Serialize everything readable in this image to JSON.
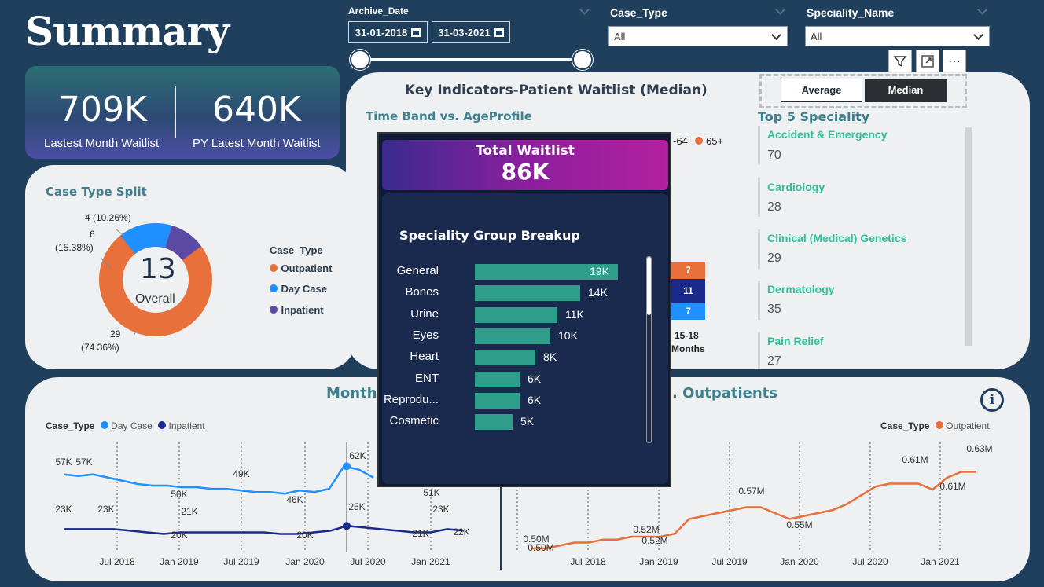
{
  "page_title": "Summary",
  "filters": {
    "archive_label": "Archive_Date",
    "date_from": "31-01-2018",
    "date_to": "31-03-2021",
    "case_type_label": "Case_Type",
    "case_type_value": "All",
    "speciality_label": "Speciality_Name",
    "speciality_value": "All"
  },
  "kpi": {
    "latest_value": "709K",
    "latest_label": "Lastest Month Waitlist",
    "py_value": "640K",
    "py_label": "PY Latest Month Waitlist"
  },
  "toggle": {
    "average": "Average",
    "median": "Median",
    "selected": "Median"
  },
  "key_indicators": {
    "title": "Key Indicators-Patient Waitlist (Median)",
    "timeband_title": "Time Band vs. AgeProfile",
    "legend_partial_1": "-64",
    "legend_partial_2": "65+",
    "visible_bar_values": [
      "7",
      "11",
      "7"
    ],
    "visible_category": "15-18",
    "visible_category_2": "Months"
  },
  "top5": {
    "title": "Top 5 Speciality",
    "items": [
      {
        "name": "Accident & Emergency",
        "value": "70"
      },
      {
        "name": "Cardiology",
        "value": "28"
      },
      {
        "name": "Clinical (Medical) Genetics",
        "value": "29"
      },
      {
        "name": "Dermatology",
        "value": "35"
      },
      {
        "name": "Pain Relief",
        "value": "27"
      }
    ]
  },
  "case_split": {
    "title": "Case Type Split",
    "center_value": "13",
    "center_label": "Overall",
    "legend_title": "Case_Type",
    "legend": [
      {
        "name": "Outpatient",
        "color": "#e8703a"
      },
      {
        "name": "Day Case",
        "color": "#1e90ff"
      },
      {
        "name": "Inpatient",
        "color": "#5b4aa3"
      }
    ],
    "labels": {
      "inpatient": "4 (10.26%)",
      "daycase_a": "6",
      "daycase_b": "(15.38%)",
      "outpatient_a": "29",
      "outpatient_b": "(74.36%)"
    }
  },
  "tooltip": {
    "title": "Total Waitlist",
    "value": "86K",
    "breakup_title": "Speciality Group Breakup",
    "rows": [
      {
        "label": "General",
        "value": 19,
        "text": "19K"
      },
      {
        "label": "Bones",
        "value": 14,
        "text": "14K"
      },
      {
        "label": "Urine",
        "value": 11,
        "text": "11K"
      },
      {
        "label": "Eyes",
        "value": 10,
        "text": "10K"
      },
      {
        "label": "Heart",
        "value": 8,
        "text": "8K"
      },
      {
        "label": "ENT",
        "value": 6,
        "text": "6K"
      },
      {
        "label": "Reprodu...",
        "value": 6,
        "text": "6K"
      },
      {
        "label": "Cosmetic",
        "value": 5,
        "text": "5K"
      }
    ]
  },
  "monthly": {
    "title_left": "Monthl",
    "title_right": ". Outpatients",
    "legend_left_title": "Case_Type",
    "legend_left": [
      "Day Case",
      "Inpatient"
    ],
    "legend_right_title": "Case_Type",
    "legend_right": [
      "Outpatient"
    ],
    "x_ticks": [
      "Jul 2018",
      "Jan 2019",
      "Jul 2019",
      "Jan 2020",
      "Jul 2020",
      "Jan 2021"
    ]
  },
  "chart_data": [
    {
      "type": "line",
      "series": [
        {
          "name": "Day Case",
          "color": "#1e90ff",
          "values": [
            57,
            56,
            57,
            55,
            53,
            51,
            50,
            50,
            49,
            49,
            48,
            48,
            47,
            46,
            46,
            45,
            47,
            46,
            48,
            62,
            60,
            55
          ]
        },
        {
          "name": "Inpatient",
          "color": "#1a2a8c",
          "values": [
            23,
            23,
            23,
            23,
            22,
            21,
            20,
            21,
            21,
            21,
            21,
            21,
            21,
            20,
            20,
            21,
            22,
            25,
            24,
            23,
            22,
            21,
            21,
            23,
            22
          ]
        }
      ],
      "point_labels": [
        {
          "series": "Day Case",
          "labels": [
            "57K",
            "57K",
            "50K",
            "49K",
            "46K",
            "62K",
            "51K"
          ]
        },
        {
          "series": "Inpatient",
          "labels": [
            "23K",
            "23K",
            "21K",
            "20K",
            "20K",
            "25K",
            "21K",
            "23K",
            "22K"
          ]
        }
      ]
    },
    {
      "type": "line",
      "series": [
        {
          "name": "Outpatient",
          "color": "#e8703a",
          "values": [
            0.5,
            0.5,
            0.505,
            0.51,
            0.51,
            0.515,
            0.515,
            0.52,
            0.52,
            0.52,
            0.525,
            0.55,
            0.555,
            0.56,
            0.565,
            0.57,
            0.57,
            0.56,
            0.55,
            0.555,
            0.56,
            0.565,
            0.575,
            0.59,
            0.605,
            0.61,
            0.61,
            0.61,
            0.6,
            0.62,
            0.63,
            0.63
          ]
        }
      ],
      "point_labels": [
        "0.50M",
        "0.50M",
        "0.52M",
        "0.52M",
        "0.57M",
        "0.55M",
        "0.61M",
        "0.61M",
        "0.63M"
      ]
    }
  ]
}
